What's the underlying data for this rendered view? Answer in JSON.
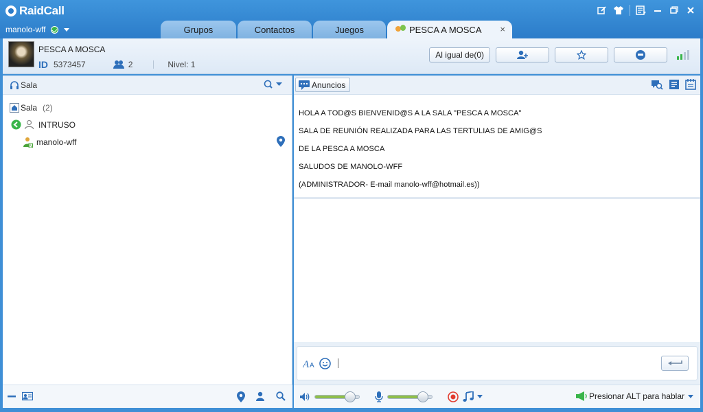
{
  "app": {
    "name": "RaidCall"
  },
  "user": {
    "name": "manolo-wff"
  },
  "tabs": [
    {
      "label": "Grupos"
    },
    {
      "label": "Contactos"
    },
    {
      "label": "Juegos"
    },
    {
      "label": "PESCA A MOSCA",
      "close": "×"
    }
  ],
  "room": {
    "title": "PESCA A MOSCA",
    "id_label": "ID",
    "id_value": "5373457",
    "member_count": "2",
    "level": "Nivel: 1",
    "like_button": "Al igual de(0)"
  },
  "left_panel": {
    "header": "Sala",
    "tree": {
      "root_label": "Sala",
      "root_count": "(2)",
      "group_label": "INTRUSO",
      "member_name": "manolo-wff"
    }
  },
  "right_panel": {
    "announce_button": "Anuncios",
    "announcement_lines": [
      "HOLA A TOD@S BIENVENID@S A LA SALA \"PESCA A MOSCA\"",
      "SALA DE REUNIÓN REALIZADA PARA LAS TERTULIAS DE AMIG@S",
      "DE LA PESCA A MOSCA",
      "SALUDOS DE MANOLO-WFF",
      "(ADMINISTRADOR- E-mail manolo-wff@hotmail.es))"
    ]
  },
  "voice": {
    "speaker_volume": 0.8,
    "mic_volume": 0.8,
    "push_to_talk": "Presionar ALT para hablar"
  },
  "colors": {
    "titlebar": "#3f95dc",
    "accent": "#2e6fba",
    "online": "#39b54a"
  }
}
